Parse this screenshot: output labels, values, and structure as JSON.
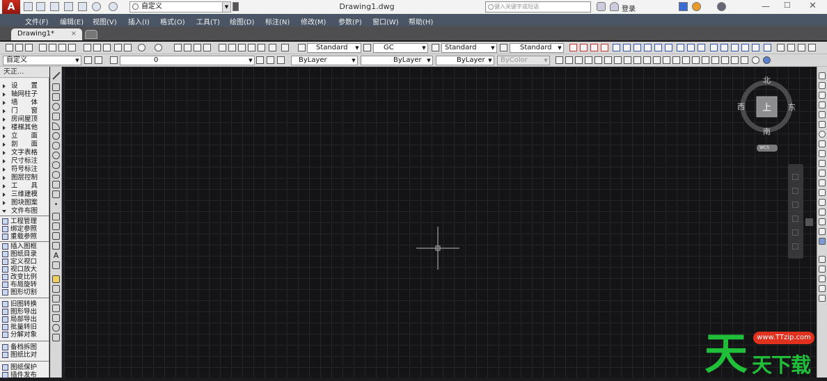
{
  "app": {
    "logo_letter": "A",
    "document_title": "Drawing1.dwg"
  },
  "workspace": {
    "value": "自定义"
  },
  "search": {
    "placeholder": "键入关键字或短语"
  },
  "user": {
    "login": "登录"
  },
  "menu": [
    "文件(F)",
    "编辑(E)",
    "视图(V)",
    "插入(I)",
    "格式(O)",
    "工具(T)",
    "绘图(D)",
    "标注(N)",
    "修改(M)",
    "参数(P)",
    "窗口(W)",
    "帮助(H)"
  ],
  "doc_tab": {
    "label": "Drawing1*",
    "close": "×"
  },
  "styles": {
    "text_style": "Standard",
    "dim_style": "GC",
    "table_style": "Standard",
    "multileader_style": "Standard"
  },
  "props": {
    "workspace2": "自定义",
    "layer": "0",
    "color": "ByLayer",
    "linetype": "ByLayer",
    "lineweight": "ByLayer",
    "plotstyle": "ByColor"
  },
  "tianzheng": {
    "title": "天正...",
    "categories": [
      "设　　置",
      "轴网柱子",
      "墙　　体",
      "门　　窗",
      "房间屋顶",
      "楼梯其他",
      "立　　面",
      "剖　　面",
      "文字表格",
      "尺寸标注",
      "符号标注",
      "图层控制",
      "工　　具",
      "三维建模",
      "图块图案",
      "文件布图"
    ],
    "actions_a": [
      "工程管理",
      "绑定参照",
      "重载参照"
    ],
    "actions_b": [
      "插入图框",
      "图纸目录",
      "定义视口",
      "视口放大",
      "改变比例",
      "布局旋转",
      "图形切割"
    ],
    "actions_c": [
      "旧图转换",
      "图形导出",
      "局部导出",
      "批量转旧",
      "分解对象"
    ],
    "actions_d": [
      "备档拆图",
      "图纸比对"
    ],
    "actions_e": [
      "图纸保护",
      "插件发布"
    ]
  },
  "viewcube": {
    "north": "北",
    "south": "南",
    "east": "东",
    "west": "西",
    "top": "上",
    "wcs": "WCS"
  },
  "watermark": {
    "big": "天",
    "small": "天下载",
    "url": "www.TTzip.com"
  },
  "colors": {
    "canvas": "#141416",
    "grid_minor": "#262628",
    "grid_major": "#323236",
    "toolbar": "#d7d7d7",
    "menubar": "#4a5666",
    "watermark_green": "#1fbf3a",
    "watermark_red": "#e0301e"
  }
}
